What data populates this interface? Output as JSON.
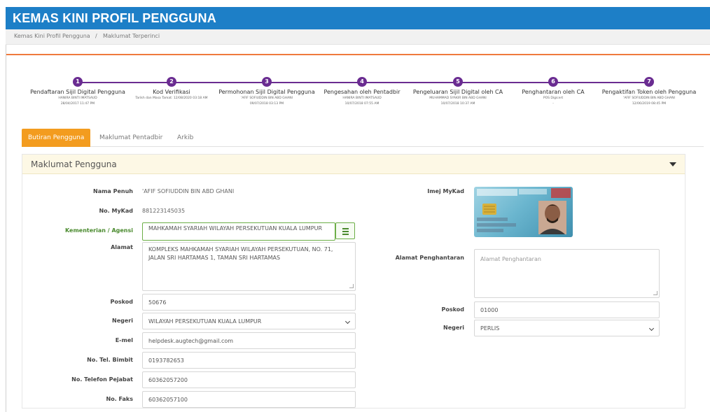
{
  "header": {
    "title": "KEMAS KINI PROFIL PENGGUNA"
  },
  "breadcrumb": {
    "items": [
      "Kemas Kini Profil Pengguna",
      "Maklumat Terperinci"
    ],
    "separator": "/"
  },
  "progress": {
    "steps": [
      {
        "number": "1",
        "title": "Pendaftaran Sijil Digital Pengguna",
        "line1": "HANIRA BINTI IMATSAUD",
        "line2": "28/04/2017 11:47 PM"
      },
      {
        "number": "2",
        "title": "Kod Verifikasi",
        "line1": "Tarikh dan Masa Tamat: 12/08/2020 03:18 AM",
        "line2": ""
      },
      {
        "number": "3",
        "title": "Permohonan Sijil Digital Pengguna",
        "line1": "'AFIF SOFIUDDIN BIN ABD GHANI",
        "line2": "09/07/2018 03:13 PM"
      },
      {
        "number": "4",
        "title": "Pengesahan oleh Pentadbir",
        "line1": "HANIRA BINTI IMATSAUD",
        "line2": "10/07/2018 07:55 AM"
      },
      {
        "number": "5",
        "title": "Pengeluaran Sijil Digital oleh CA",
        "line1": "MUHAMMAD SYAKIR BIN ABD GHANI",
        "line2": "10/07/2018 10:37 AM"
      },
      {
        "number": "6",
        "title": "Penghantaran oleh CA",
        "line1": "POS Digicert",
        "line2": "-"
      },
      {
        "number": "7",
        "title": "Pengaktifan Token oleh Pengguna",
        "line1": "'AFIF SOFIUDDIN BIN ABD GHANI",
        "line2": "12/06/2019 08:45 PM"
      }
    ],
    "color": "#6a2c91"
  },
  "tabs": [
    {
      "label": "Butiran Pengguna",
      "active": true
    },
    {
      "label": "Maklumat Pentadbir",
      "active": false
    },
    {
      "label": "Arkib",
      "active": false
    }
  ],
  "panel": {
    "title": "Maklumat Pengguna",
    "nama_penuh": {
      "label": "Nama Penuh",
      "value": "'AFIF SOFIUDDIN BIN ABD GHANI"
    },
    "mykad": {
      "label": "No. MyKad",
      "value": "881223145035"
    },
    "kementerian": {
      "label": "Kementerian / Agensi",
      "value": "MAHKAMAH SYARIAH WILAYAH PERSEKUTUAN KUALA LUMPUR"
    },
    "alamat": {
      "label": "Alamat",
      "value": "KOMPLEKS MAHKAMAH SYARIAH WILAYAH PERSEKUTUAN, NO. 71, JALAN SRI HARTAMAS 1, TAMAN SRI HARTAMAS"
    },
    "poskod": {
      "label": "Poskod",
      "value": "50676"
    },
    "negeri": {
      "label": "Negeri",
      "value": "WILAYAH PERSEKUTUAN KUALA LUMPUR"
    },
    "emel": {
      "label": "E-mel",
      "value": "helpdesk.augtech@gmail.com"
    },
    "tel_bimbit": {
      "label": "No. Tel. Bimbit",
      "value": "0193782653"
    },
    "tel_pejabat": {
      "label": "No. Telefon Pejabat",
      "value": "60362057200"
    },
    "faks": {
      "label": "No. Faks",
      "value": "60362057100"
    },
    "imej_mykad": {
      "label": "Imej MyKad"
    },
    "alamat_penghantaran": {
      "label": "Alamat Penghantaran",
      "placeholder": "Alamat Penghantaran"
    },
    "poskod2": {
      "label": "Poskod",
      "value": "01000"
    },
    "negeri2": {
      "label": "Negeri",
      "value": "PERLIS"
    }
  },
  "colors": {
    "header": "#1d7fc7",
    "accent_tab": "#f39c1f",
    "rule": "#ef7a3d",
    "valid_border": "#6cae47"
  }
}
